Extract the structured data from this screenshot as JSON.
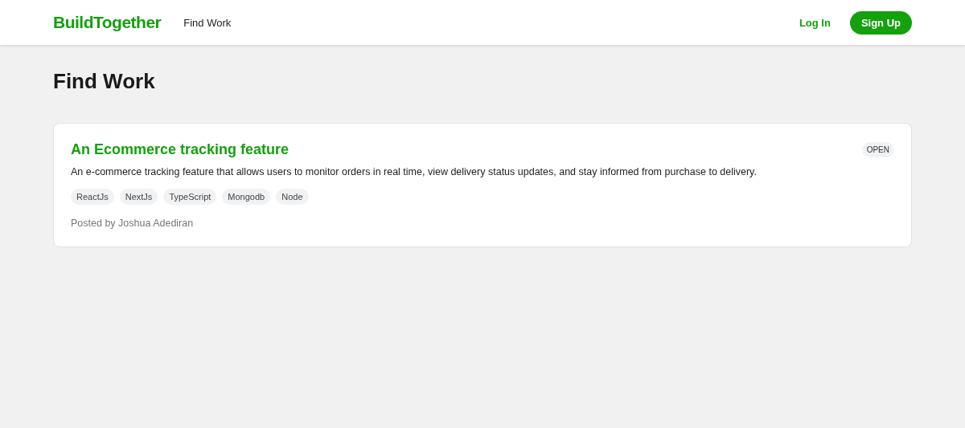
{
  "header": {
    "logo": "BuildTogether",
    "nav": [
      {
        "label": "Find Work"
      }
    ],
    "login": "Log In",
    "signup": "Sign Up"
  },
  "page_title": "Find Work",
  "jobs": [
    {
      "title": "An Ecommerce tracking feature",
      "status": "OPEN",
      "description": "An e-commerce tracking feature that allows users to monitor orders in real time, view delivery status updates, and stay informed from purchase to delivery.",
      "tags": [
        "ReactJs",
        "NextJs",
        "TypeScript",
        "Mongodb",
        "Node"
      ],
      "posted_by": "Posted by Joshua Adediran"
    }
  ]
}
